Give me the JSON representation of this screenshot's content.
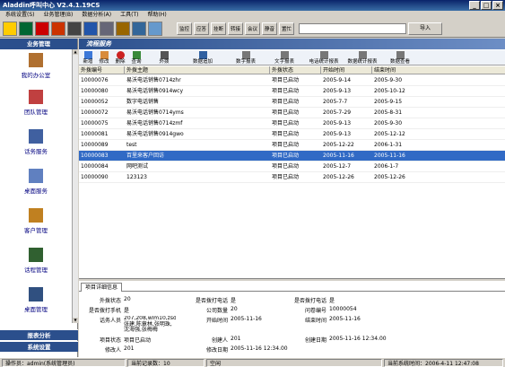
{
  "app": {
    "title": "Aladdin呼叫中心 V2.4.1.19CS"
  },
  "window_controls": {
    "minimize": "_",
    "maximize": "□",
    "close": "×"
  },
  "menu": [
    {
      "label": "系统设置(S)"
    },
    {
      "label": "业务管理(B)"
    },
    {
      "label": "数据分析(A)"
    },
    {
      "label": "工具(T)"
    },
    {
      "label": "帮助(H)"
    }
  ],
  "toolbar": {
    "buttons": [
      "监控",
      "应答",
      "挂断",
      "转接",
      "会议",
      "静音",
      "置忙",
      "呼出"
    ],
    "import_label": "导入",
    "input_value": ""
  },
  "sidebar": {
    "header": "业务管理",
    "items": [
      {
        "label": "我的办公室",
        "icon": "office-icon"
      },
      {
        "label": "团队管理",
        "icon": "team-icon"
      },
      {
        "label": "话务服务",
        "icon": "telephony-icon"
      },
      {
        "label": "桌面服务",
        "icon": "desktop-icon"
      },
      {
        "label": "客户管理",
        "icon": "customer-icon"
      },
      {
        "label": "话程管理",
        "icon": "process-icon"
      },
      {
        "label": "桌面管理",
        "icon": "desktop-manage-icon"
      }
    ],
    "footers": [
      "报表分析",
      "系统设置"
    ]
  },
  "main": {
    "header": "流程服务",
    "actions": [
      {
        "label": "新增",
        "icon": "add-icon"
      },
      {
        "label": "修改",
        "icon": "edit-icon"
      },
      {
        "label": "删除",
        "icon": "delete-icon"
      },
      {
        "label": "查询",
        "icon": "search-icon"
      },
      {
        "label": "外拨",
        "icon": "outbound-icon"
      },
      {
        "label": "数据追加",
        "icon": "data-append-icon"
      },
      {
        "label": "数字报表",
        "icon": "report-icon"
      },
      {
        "label": "文字报表",
        "icon": "text-report-icon"
      },
      {
        "label": "电话统计报表",
        "icon": "call-stats-icon"
      },
      {
        "label": "数据统计报表",
        "icon": "data-stats-icon"
      },
      {
        "label": "数据查看",
        "icon": "data-view-icon"
      }
    ],
    "table": {
      "columns": [
        "外拨编号",
        "外拨主题",
        "外拨状态",
        "开始时间",
        "结束时间"
      ],
      "rows": [
        [
          "10000076",
          "易沃电话销售0714zhr",
          "项目已启动",
          "2005-9-14",
          "2005-9-30"
        ],
        [
          "10000080",
          "易沃电话销售0914wcy",
          "项目已启动",
          "2005-9-13",
          "2005-10-12"
        ],
        [
          "10000052",
          "数字电话销售",
          "项目已启动",
          "2005-7-7",
          "2005-9-15"
        ],
        [
          "10000072",
          "易沃电话销售0714yms",
          "项目已启动",
          "2005-7-29",
          "2005-8-31"
        ],
        [
          "10000075",
          "易沃电话销售0714zmf",
          "项目已启动",
          "2005-9-13",
          "2005-9-30"
        ],
        [
          "10000081",
          "易沃电话销售0914gwo",
          "项目已启动",
          "2005-9-13",
          "2005-12-12"
        ],
        [
          "10000089",
          "test",
          "项目已启动",
          "2005-12-22",
          "2006-1-31"
        ],
        [
          "10000083",
          "百里来客户回访",
          "项目已启动",
          "2005-11-16",
          "2005-11-16"
        ],
        [
          "10000084",
          "网吧测试",
          "项目已启动",
          "2005-12-7",
          "2006-1-7"
        ],
        [
          "10000090",
          "123123",
          "项目已启动",
          "2005-12-26",
          "2005-12-26"
        ]
      ],
      "selected_index": 7
    },
    "detail": {
      "tab": "项目详细信息",
      "fields": {
        "out_status_label": "外拨状态",
        "out_status": "20",
        "auto_dial_label": "是否拨打电话",
        "auto_dial": "是",
        "dial_phone_label": "是否拨打电话",
        "dial_phone": "是",
        "mobile_label": "是否拨打手机",
        "mobile": "是",
        "company_label": "公司数量",
        "company": "20",
        "survey_label": "问卷编号",
        "survey": "10000054",
        "agents_label": "话务人员",
        "agents": "207,208,wlm10,zsd,dyhy,张建,陈章林,张明珠,沈海强,张梅梅",
        "start_label": "开始时间",
        "start": "2005-11-16",
        "end_label": "结束时间",
        "end": "2005-11-16",
        "project_status_label": "项目状态",
        "project_status": "项目已启动",
        "creator_label": "创建人",
        "creator": "201",
        "created_label": "创建日期",
        "created": "2005-11-16 12:34.00",
        "modifier_label": "修改人",
        "modifier": "201",
        "modified_label": "修改日期",
        "modified": "2005-11-16 12:34.00"
      }
    }
  },
  "status": {
    "operator": "操作员：admin(系统管理员)",
    "records": "当前记录数：10",
    "state": "空闲",
    "time": "当前系统时间：2006-4-11 12:47:08"
  }
}
